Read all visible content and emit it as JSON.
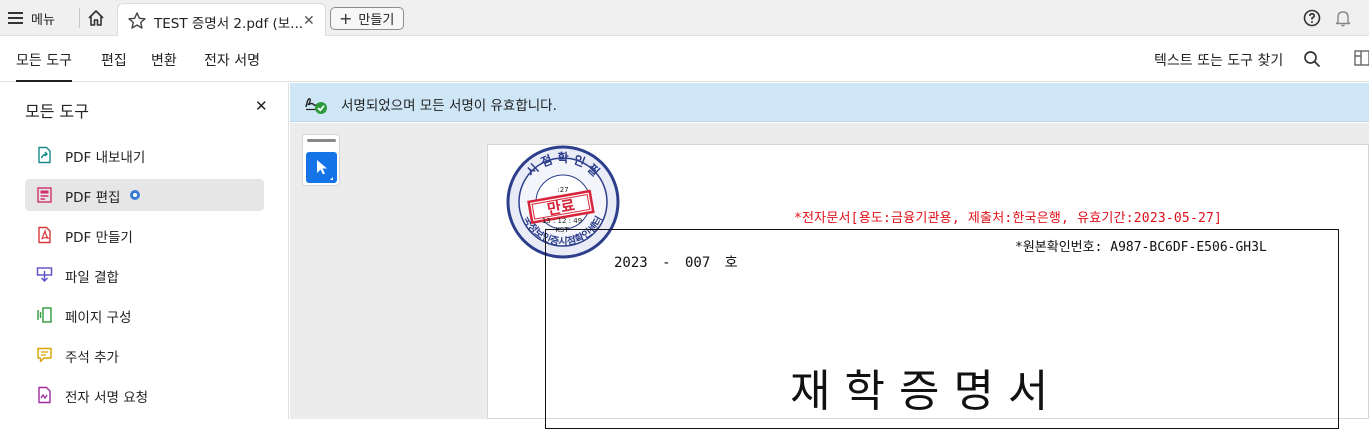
{
  "tabbar": {
    "menu_label": "메뉴",
    "doc_tab_title": "TEST 증명서 2.pdf (보...",
    "create_label": "만들기"
  },
  "toolbar": {
    "tabs": [
      "모든 도구",
      "편집",
      "변환",
      "전자 서명"
    ],
    "active_tab": "모든 도구",
    "find_label": "텍스트 또는 도구 찾기"
  },
  "left_panel": {
    "title": "모든 도구",
    "items": [
      {
        "label": "PDF 내보내기",
        "icon": "export-pdf-icon",
        "color": "#1a8a8a"
      },
      {
        "label": "PDF 편집",
        "icon": "edit-pdf-icon",
        "color": "#d0306e",
        "selected": true,
        "badge": true
      },
      {
        "label": "PDF 만들기",
        "icon": "create-pdf-icon",
        "color": "#d8383a"
      },
      {
        "label": "파일 결합",
        "icon": "combine-files-icon",
        "color": "#5a4fc7"
      },
      {
        "label": "페이지 구성",
        "icon": "organize-pages-icon",
        "color": "#2d9b3c"
      },
      {
        "label": "주석 추가",
        "icon": "comment-icon",
        "color": "#d9a400"
      },
      {
        "label": "전자 서명 요청",
        "icon": "request-esign-icon",
        "color": "#a02b9c"
      }
    ]
  },
  "signature_banner": {
    "text": "서명되었으며 모든 서명이 유효합니다."
  },
  "document": {
    "stamp": {
      "top_text": "시 점 확 인 필",
      "center_label": "만료",
      "time": "13 : 12 : 49",
      "timezone": "KST",
      "date_partial": ":27",
      "bottom_text": "국정보인증시점확인센터"
    },
    "red_notice": "*전자문서[용도:금융기관용, 제출처:한국은행, 유효기간:2023-05-27]",
    "original_number": "*원본확인번호:  A987-BC6DF-E506-GH3L",
    "doc_number": "2023 - 007  호",
    "title": "재학증명서"
  },
  "colors": {
    "accent": "#1473e6",
    "banner": "#cfe6f7",
    "red": "#e0101a",
    "stamp_blue": "#2c3e8c"
  }
}
